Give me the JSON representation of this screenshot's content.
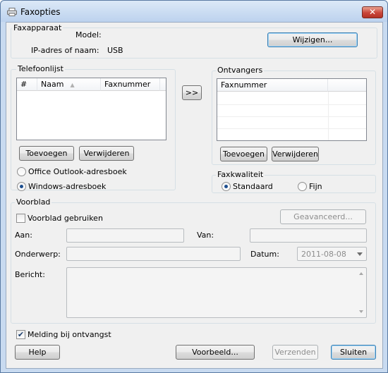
{
  "window": {
    "title": "Faxopties",
    "close_glyph": "✕"
  },
  "faxapparaat": {
    "group_label": "Faxapparaat",
    "model_label": "Model:",
    "model_value": "",
    "ip_label": "IP-adres of naam:",
    "ip_value": "USB",
    "change_button": "Wijzigen..."
  },
  "telefoonlijst": {
    "group_label": "Telefoonlijst",
    "columns": [
      "#",
      "Naam",
      "Faxnummer"
    ],
    "sort_icon": "▲",
    "rows": [],
    "add_button": "Toevoegen",
    "remove_button": "Verwijderen",
    "address_books": [
      {
        "label": "Office Outlook-adresboek",
        "selected": false
      },
      {
        "label": "Windows-adresboek",
        "selected": true
      }
    ]
  },
  "move_button": ">>",
  "ontvangers": {
    "group_label": "Ontvangers",
    "columns": [
      "Faxnummer"
    ],
    "rows": [],
    "add_button": "Toevoegen",
    "remove_button": "Verwijderen"
  },
  "faxkwaliteit": {
    "group_label": "Faxkwaliteit",
    "options": [
      {
        "label": "Standaard",
        "selected": true
      },
      {
        "label": "Fijn",
        "selected": false
      }
    ]
  },
  "voorblad": {
    "group_label": "Voorblad",
    "use_label": "Voorblad gebruiken",
    "use_checked": false,
    "advanced_button": "Geavanceerd...",
    "aan_label": "Aan:",
    "aan_value": "",
    "van_label": "Van:",
    "van_value": "",
    "onderwerp_label": "Onderwerp:",
    "onderwerp_value": "",
    "datum_label": "Datum:",
    "datum_value": "2011-08-08",
    "bericht_label": "Bericht:",
    "bericht_value": ""
  },
  "melding": {
    "label": "Melding bij ontvangst",
    "checked": true,
    "check_glyph": "✔"
  },
  "footer": {
    "help_button": "Help",
    "preview_button": "Voorbeeld...",
    "send_button": "Verzenden",
    "close_button": "Sluiten"
  },
  "colors": {
    "title_bar": "#c8daf0",
    "close_button": "#c9463a",
    "dialog_background": "#f0f0f0",
    "group_border": "#d5dfe5",
    "selected_radio": "#1c4e8f",
    "disabled_text": "#8d8d8d"
  }
}
